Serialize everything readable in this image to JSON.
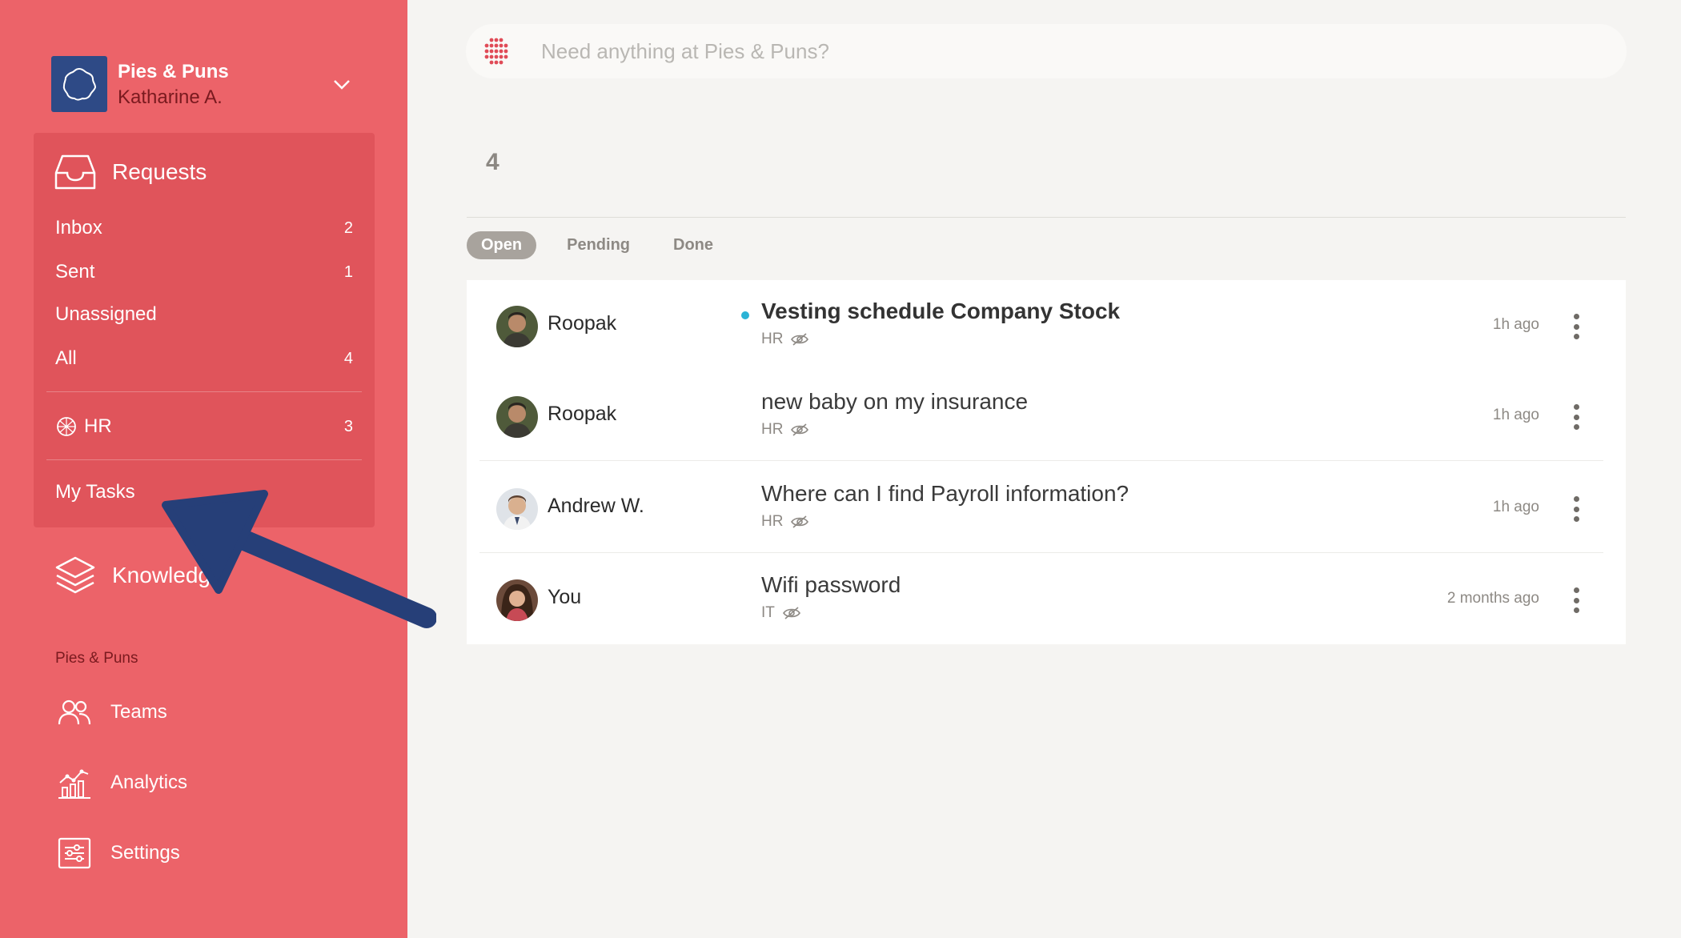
{
  "org": {
    "name": "Pies & Puns",
    "user": "Katharine A."
  },
  "requests": {
    "title": "Requests",
    "items": [
      {
        "label": "Inbox",
        "count": "2"
      },
      {
        "label": "Sent",
        "count": "1"
      },
      {
        "label": "Unassigned",
        "count": ""
      },
      {
        "label": "All",
        "count": "4"
      }
    ],
    "team": {
      "label": "HR",
      "count": "3"
    },
    "my_tasks": "My Tasks"
  },
  "knowledge": {
    "label": "Knowledge"
  },
  "section": {
    "label": "Pies & Puns"
  },
  "links": [
    {
      "label": "Teams",
      "icon": "teams-icon"
    },
    {
      "label": "Analytics",
      "icon": "analytics-icon"
    },
    {
      "label": "Settings",
      "icon": "settings-icon"
    }
  ],
  "search": {
    "placeholder": "Need anything at Pies & Puns?"
  },
  "main": {
    "count": "4",
    "tabs": [
      {
        "label": "Open"
      },
      {
        "label": "Pending"
      },
      {
        "label": "Done"
      }
    ],
    "rows": [
      {
        "name": "Roopak",
        "subject": "Vesting schedule Company Stock",
        "team": "HR",
        "time": "1h ago",
        "unread": true
      },
      {
        "name": "Roopak",
        "subject": "new baby on my insurance",
        "team": "HR",
        "time": "1h ago",
        "unread": false
      },
      {
        "name": "Andrew W.",
        "subject": "Where can I find Payroll information?",
        "team": "HR",
        "time": "1h ago",
        "unread": false
      },
      {
        "name": "You",
        "subject": "Wifi password",
        "team": "IT",
        "time": "2 months ago",
        "unread": false
      }
    ]
  },
  "colors": {
    "sidebar": "#ec6369",
    "panel": "#e0545b",
    "accent_blue": "#2e4a86",
    "unread_dot": "#2bb3d6"
  }
}
